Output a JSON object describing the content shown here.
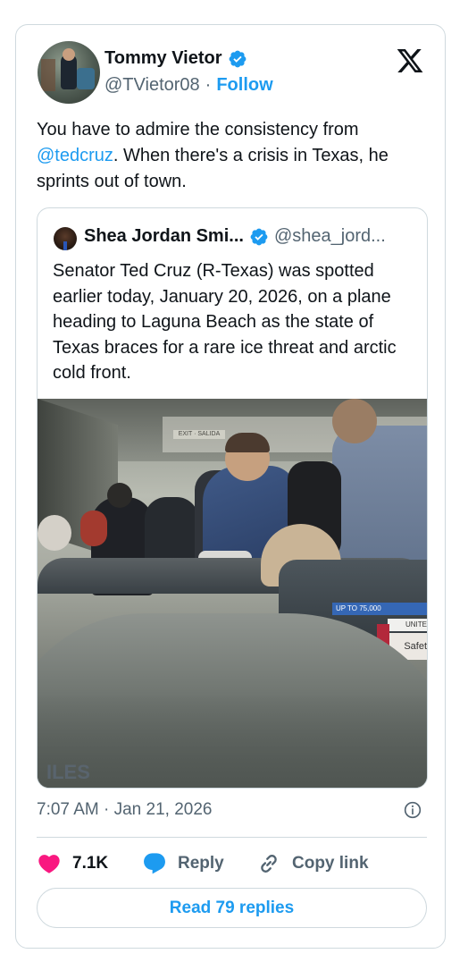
{
  "author": {
    "display_name": "Tommy Vietor",
    "handle": "@TVietor08",
    "separator": "·",
    "follow_label": "Follow"
  },
  "tweet": {
    "text_before": "You have to admire the consistency from ",
    "mention": "@tedcruz",
    "text_after": ". When there's a crisis in Texas, he sprints out of town.",
    "timestamp": "7:07 AM · Jan 21, 2026"
  },
  "quoted": {
    "display_name": "Shea Jordan Smi...",
    "handle": "@shea_jord...",
    "text": "Senator Ted Cruz (R-Texas) was spotted earlier today, January 20, 2026, on a plane heading to Laguna Beach as the state of Texas braces for a rare ice threat and arctic cold front.",
    "photo_signs": {
      "exit": "EXIT · SALIDA",
      "banner": "UP TO 75,000",
      "brand": "UNITE",
      "safety": "Safet",
      "seat_text": "ILES"
    }
  },
  "actions": {
    "likes": "7.1K",
    "reply_label": "Reply",
    "copy_label": "Copy link"
  },
  "read_replies_label": "Read 79 replies",
  "colors": {
    "accent": "#1d9bf0",
    "like": "#f91880",
    "text": "#0f1419",
    "muted": "#536471",
    "border": "#cfd9de"
  },
  "icons": [
    "verified-badge-icon",
    "x-logo-icon",
    "info-icon",
    "heart-icon",
    "reply-bubble-icon",
    "link-icon"
  ]
}
